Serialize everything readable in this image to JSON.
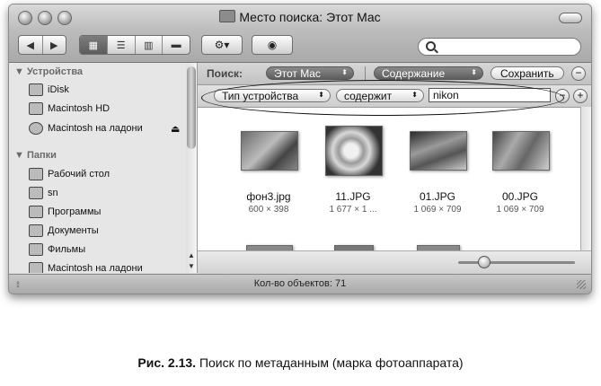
{
  "window": {
    "title": "Место поиска: Этот Mac"
  },
  "toolbar": {
    "back_icon": "back-arrow-icon",
    "forward_icon": "forward-arrow-icon",
    "view_icons": [
      "icon-view-icon",
      "list-view-icon",
      "column-view-icon",
      "coverflow-view-icon"
    ],
    "action_icon": "gear-icon",
    "quicklook_icon": "eye-icon",
    "search_placeholder": ""
  },
  "sidebar": {
    "devices_header": "Устройства",
    "devices": [
      {
        "label": "iDisk",
        "icon": "idisk-icon"
      },
      {
        "label": "Macintosh HD",
        "icon": "hard-drive-icon"
      },
      {
        "label": "Macintosh на ладони",
        "icon": "disc-icon",
        "eject": "⏏"
      }
    ],
    "places_header": "Папки",
    "places": [
      {
        "label": "Рабочий стол",
        "icon": "desktop-icon"
      },
      {
        "label": "sn",
        "icon": "home-icon"
      },
      {
        "label": "Программы",
        "icon": "applications-icon"
      },
      {
        "label": "Документы",
        "icon": "documents-icon"
      },
      {
        "label": "Фильмы",
        "icon": "movies-icon"
      },
      {
        "label": "Macintosh на ладони",
        "icon": "folder-icon"
      }
    ]
  },
  "searchbar": {
    "label": "Поиск:",
    "scope": "Этот Mac",
    "content": "Содержание",
    "save": "Сохранить",
    "remove": "−"
  },
  "criteria": {
    "attribute": "Тип устройства",
    "operator": "содержит",
    "value": "nikon",
    "remove": "−",
    "add": "+"
  },
  "files": [
    {
      "name": "фон3.jpg",
      "size": "600 × 398"
    },
    {
      "name": "11.JPG",
      "size": "1 677 × 1 ..."
    },
    {
      "name": "01.JPG",
      "size": "1 069 × 709"
    },
    {
      "name": "00.JPG",
      "size": "1 069 × 709"
    }
  ],
  "status": {
    "text": "Кол-во объектов: 71"
  },
  "caption": {
    "label": "Рис. 2.13.",
    "text": " Поиск по метаданным (марка фотоаппарата)"
  }
}
